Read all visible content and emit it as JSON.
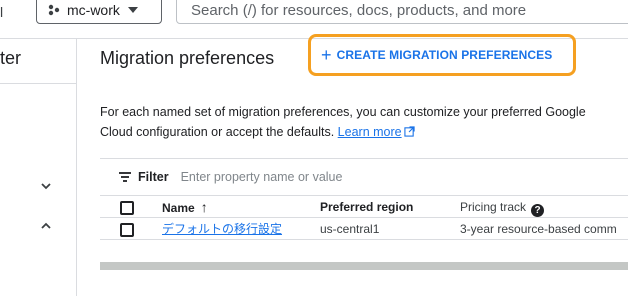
{
  "topbar": {
    "partial_left": "l",
    "project": "mc-work",
    "search_placeholder": "Search (/) for resources, docs, products, and more"
  },
  "left_nav": {
    "title": "ter"
  },
  "header": {
    "title": "Migration preferences",
    "create_button": "CREATE MIGRATION PREFERENCES"
  },
  "description": {
    "text": "For each named set of migration preferences, you can customize your preferred Google Cloud configuration or accept the defaults.",
    "link": "Learn more"
  },
  "filter": {
    "label": "Filter",
    "placeholder": "Enter property name or value"
  },
  "table": {
    "columns": {
      "name": "Name",
      "region": "Preferred region",
      "pricing": "Pricing track"
    },
    "rows": [
      {
        "name": "デフォルトの移行設定",
        "region": "us-central1",
        "pricing": "3-year resource-based comm"
      }
    ]
  },
  "colors": {
    "accent": "#1a73e8",
    "highlight": "#f5a021"
  }
}
